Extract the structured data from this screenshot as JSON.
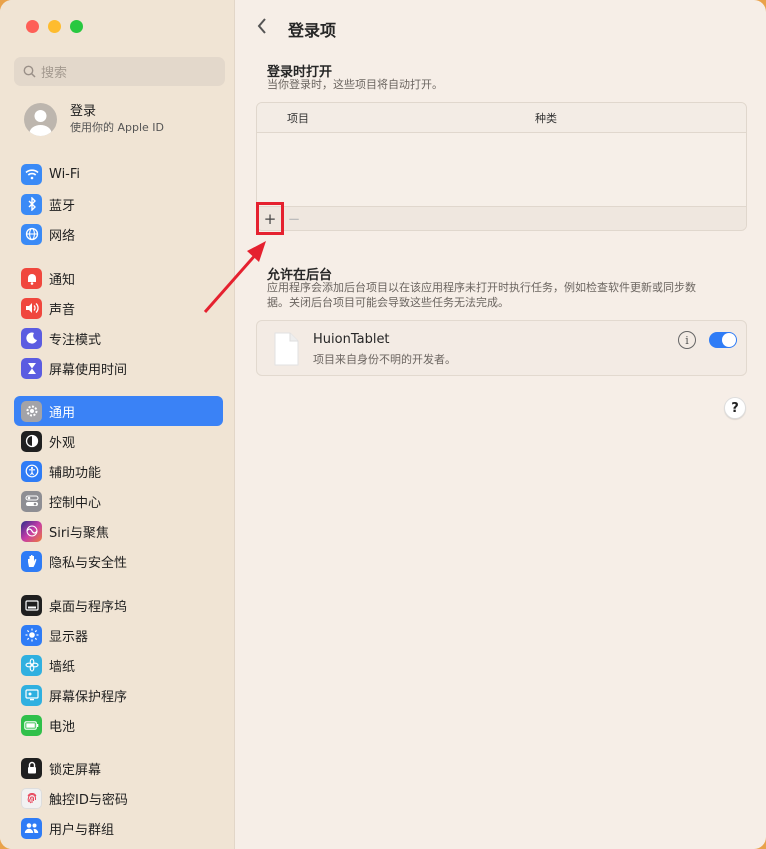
{
  "window": {
    "traffic_lights": [
      "#fe5f57",
      "#febc2e",
      "#28c840"
    ]
  },
  "sidebar": {
    "search_placeholder": "搜索",
    "account": {
      "name": "登录",
      "subtitle": "使用你的 Apple ID"
    },
    "items": [
      {
        "label": "Wi-Fi",
        "icon": "wifi-icon",
        "color": "#3a8af6"
      },
      {
        "label": "蓝牙",
        "icon": "bluetooth-icon",
        "color": "#3a8af6"
      },
      {
        "label": "网络",
        "icon": "globe-icon",
        "color": "#3a8af6"
      },
      {
        "label": "通知",
        "icon": "bell-icon",
        "color": "#f0473d"
      },
      {
        "label": "声音",
        "icon": "speaker-icon",
        "color": "#f0473d"
      },
      {
        "label": "专注模式",
        "icon": "moon-icon",
        "color": "#5b5ce1"
      },
      {
        "label": "屏幕使用时间",
        "icon": "hourglass-icon",
        "color": "#5b5ce1"
      },
      {
        "label": "通用",
        "icon": "gear-icon",
        "color": "#8e8e93",
        "active": true
      },
      {
        "label": "外观",
        "icon": "appearance-icon",
        "color": "#1f1f1f"
      },
      {
        "label": "辅助功能",
        "icon": "accessibility-icon",
        "color": "#2f7cf6"
      },
      {
        "label": "控制中心",
        "icon": "control-center-icon",
        "color": "#8e8e93"
      },
      {
        "label": "Siri与聚焦",
        "icon": "siri-icon",
        "color": "#a64ae0"
      },
      {
        "label": "隐私与安全性",
        "icon": "hand-icon",
        "color": "#2f7cf6"
      },
      {
        "label": "桌面与程序坞",
        "icon": "dock-icon",
        "color": "#1f1f1f"
      },
      {
        "label": "显示器",
        "icon": "sun-icon",
        "color": "#2f7cf6"
      },
      {
        "label": "墙纸",
        "icon": "flower-icon",
        "color": "#30b0e0"
      },
      {
        "label": "屏幕保护程序",
        "icon": "screensaver-icon",
        "color": "#30b0e0"
      },
      {
        "label": "电池",
        "icon": "battery-icon",
        "color": "#30c04a"
      },
      {
        "label": "锁定屏幕",
        "icon": "lock-icon",
        "color": "#1f1f1f"
      },
      {
        "label": "触控ID与密码",
        "icon": "fingerprint-icon",
        "color": "#f0f0f0"
      },
      {
        "label": "用户与群组",
        "icon": "users-icon",
        "color": "#2f7cf6"
      }
    ]
  },
  "main": {
    "title": "登录项",
    "login_section": {
      "title": "登录时打开",
      "subtitle": "当你登录时，这些项目将自动打开。",
      "columns": [
        "项目",
        "种类"
      ],
      "add_label": "+",
      "remove_label": "−"
    },
    "background_section": {
      "title": "允许在后台",
      "subtitle_line1": "应用程序会添加后台项目以在该应用程序未打开时执行任务，例如检查软件更新或同步数",
      "subtitle_line2": "据。关闭后台项目可能会导致这些任务无法完成。",
      "item": {
        "name": "HuionTablet",
        "description": "项目来自身份不明的开发者。",
        "enabled": true
      }
    },
    "help_label": "?"
  }
}
